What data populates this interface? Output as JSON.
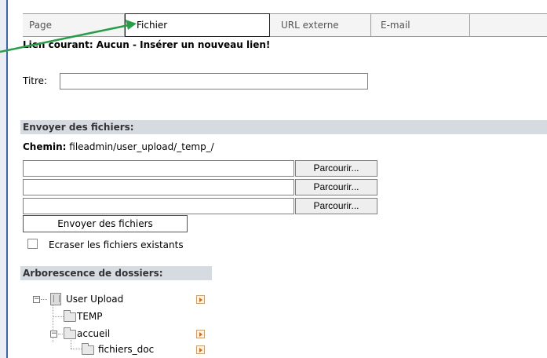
{
  "tabs": [
    {
      "label": "Page"
    },
    {
      "label": "Fichier"
    },
    {
      "label": "URL externe"
    },
    {
      "label": "E-mail"
    }
  ],
  "current_link": "Lien courant: Aucun - Insérer un nouveau lien!",
  "title_field": {
    "label": "Titre:",
    "value": ""
  },
  "upload": {
    "section_title": "Envoyer des fichiers:",
    "path_label": "Chemin:",
    "path_value": "fileadmin/user_upload/_temp_/",
    "browse_label": "Parcourir...",
    "submit_label": "Envoyer des fichiers",
    "overwrite_label": "Ecraser les fichiers existants"
  },
  "tree": {
    "section_title": "Arborescence de dossiers:",
    "items": [
      {
        "label": "User Upload"
      },
      {
        "label": "TEMP"
      },
      {
        "label": "accueil"
      },
      {
        "label": "fichiers_doc"
      }
    ]
  },
  "colors": {
    "annotation_arrow": "#2a9d4a",
    "section_bar": "#d6dbe2",
    "left_border": "#3e64a6"
  }
}
